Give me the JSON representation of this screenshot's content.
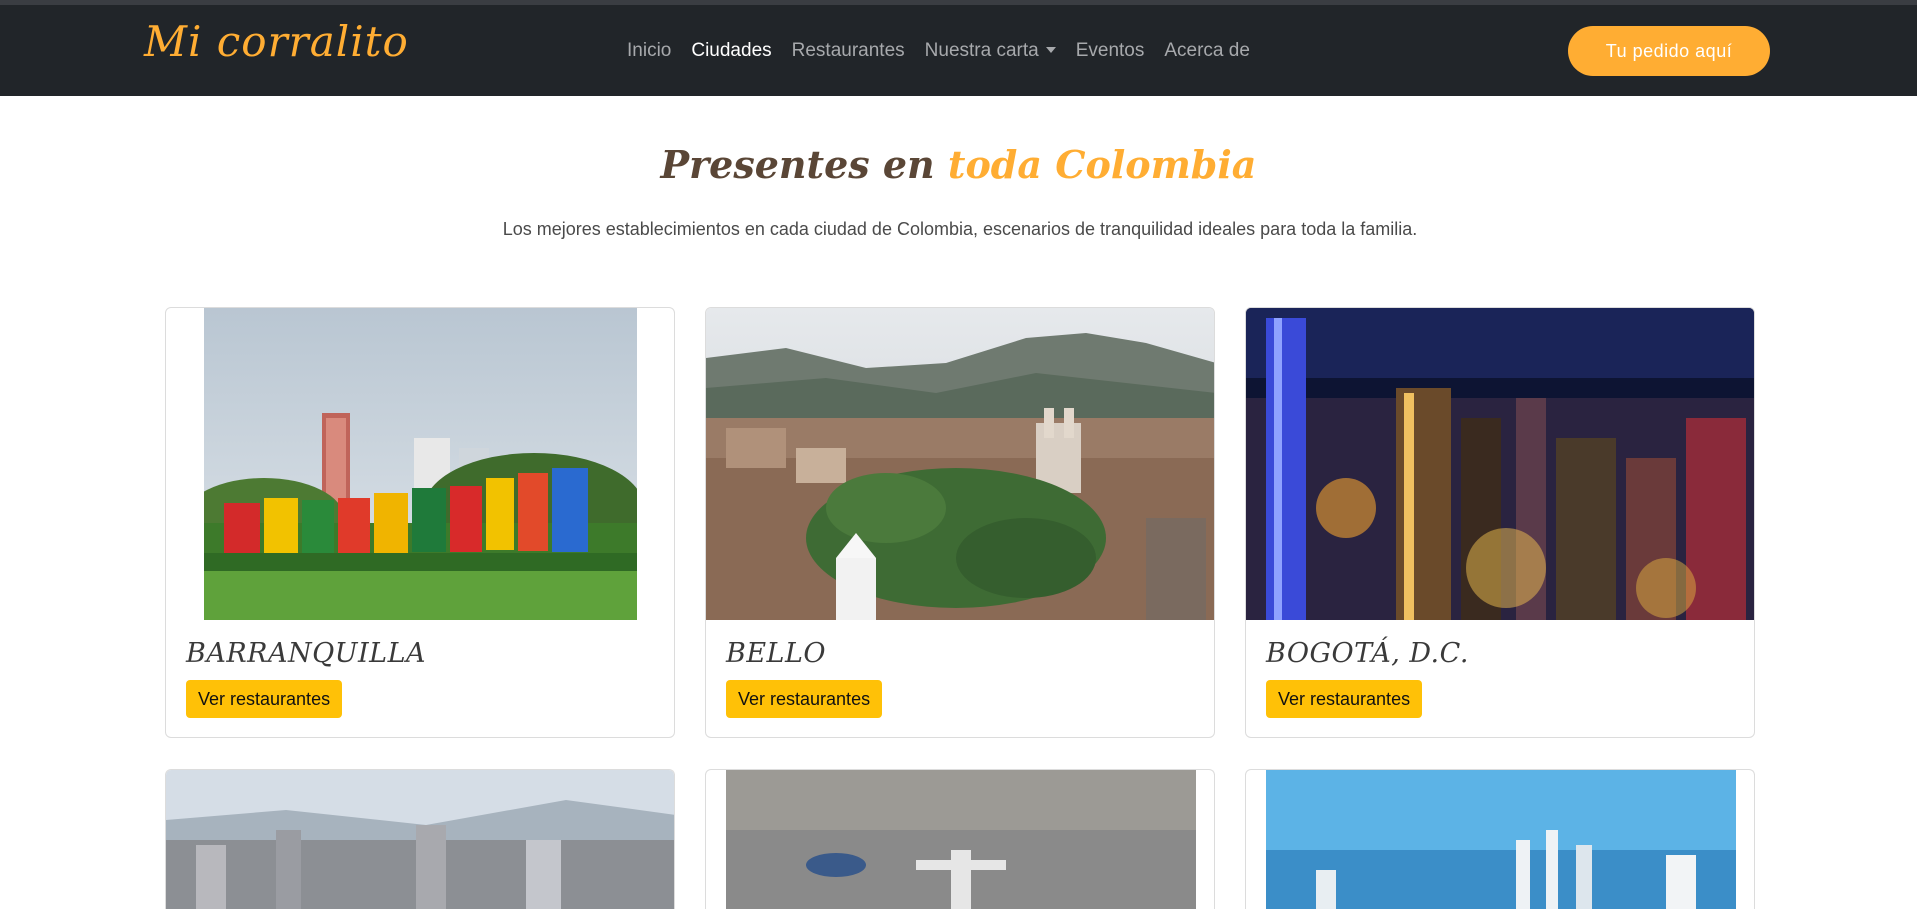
{
  "brand": "Mi corralito",
  "nav": {
    "items": [
      {
        "label": "Inicio",
        "active": false
      },
      {
        "label": "Ciudades",
        "active": true
      },
      {
        "label": "Restaurantes",
        "active": false
      },
      {
        "label": "Nuestra carta",
        "active": false,
        "dropdown": true
      },
      {
        "label": "Eventos",
        "active": false
      },
      {
        "label": "Acerca de",
        "active": false
      }
    ],
    "cta": "Tu pedido aquí"
  },
  "hero": {
    "title_part1": "Presentes en ",
    "title_part2": "toda Colombia",
    "subtitle": "Los mejores establecimientos en cada ciudad de Colombia, escenarios de tranquilidad ideales para toda la familia."
  },
  "cities": [
    {
      "name": "BARRANQUILLA",
      "button": "Ver restaurantes",
      "image": "barranquilla-sign-photo"
    },
    {
      "name": "BELLO",
      "button": "Ver restaurantes",
      "image": "bello-aerial-photo"
    },
    {
      "name": "BOGOTÁ, D.C.",
      "button": "Ver restaurantes",
      "image": "bogota-night-skyline-photo"
    }
  ],
  "cities_partial": [
    {
      "image": "city-skyline-photo"
    },
    {
      "image": "cristo-rey-aerial-photo"
    },
    {
      "image": "coastal-skyline-photo"
    }
  ],
  "colors": {
    "accent": "#ffad33",
    "navbar": "#212529",
    "button": "#ffc107"
  }
}
